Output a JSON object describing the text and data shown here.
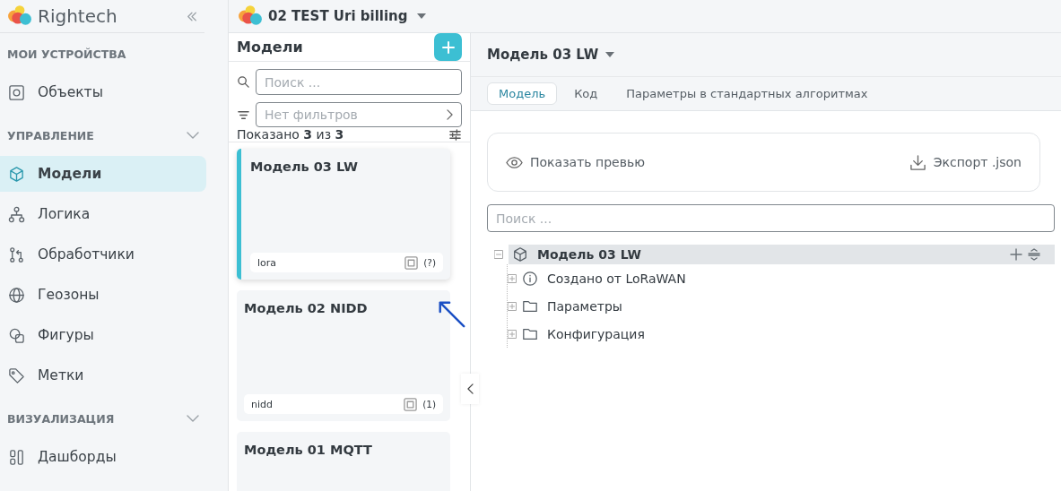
{
  "brand": {
    "name": "Rightech"
  },
  "project": {
    "title": "02 TEST Uri billing"
  },
  "sidebar": {
    "sections": [
      {
        "title": "МОИ УСТРОЙСТВА",
        "collapsible": false,
        "items": [
          {
            "label": "Объекты",
            "kind": "object",
            "selected": false
          }
        ]
      },
      {
        "title": "УПРАВЛЕНИЕ",
        "collapsible": true,
        "items": [
          {
            "label": "Модели",
            "kind": "cube",
            "selected": true
          },
          {
            "label": "Логика",
            "kind": "hierarchy",
            "selected": false
          },
          {
            "label": "Обработчики",
            "kind": "handlers",
            "selected": false
          },
          {
            "label": "Геозоны",
            "kind": "globe",
            "selected": false
          },
          {
            "label": "Фигуры",
            "kind": "shapes",
            "selected": false
          },
          {
            "label": "Метки",
            "kind": "tag",
            "selected": false
          }
        ]
      },
      {
        "title": "ВИЗУАЛИЗАЦИЯ",
        "collapsible": true,
        "items": [
          {
            "label": "Дашборды",
            "kind": "dashboard",
            "selected": false
          }
        ]
      }
    ]
  },
  "models_panel": {
    "title": "Модели",
    "search": {
      "placeholder": "Поиск ..."
    },
    "filter": {
      "placeholder": "Нет фильтров"
    },
    "count": "Показано **3** из **3**",
    "cards": [
      {
        "title": "Модель 03 LW",
        "tag": "lora",
        "count": "(?)",
        "selected": true
      },
      {
        "title": "Модель 02 NIDD",
        "tag": "nidd",
        "count": "(1)",
        "selected": false
      },
      {
        "title": "Модель 01 MQTT",
        "selected": false
      }
    ]
  },
  "detail": {
    "title": "Модель 03 LW",
    "tabs": [
      {
        "label": "Модель",
        "selected": true
      },
      {
        "label": "Код",
        "selected": false
      },
      {
        "label": "Параметры в стандартных алгоритмах",
        "selected": false
      }
    ],
    "actions": [
      {
        "label": "Показать превью",
        "kind": "eye"
      },
      {
        "label": "Экспорт .json",
        "kind": "download"
      }
    ],
    "search": {
      "placeholder": "Поиск ..."
    },
    "tree": {
      "label": "Модель 03 LW",
      "kind": "cube",
      "selected": true,
      "expanded": true,
      "children": [
        {
          "label": "Создано от LoRaWAN",
          "kind": "info",
          "expanded": false
        },
        {
          "label": "Параметры",
          "kind": "folder",
          "expanded": false
        },
        {
          "label": "Конфигурация",
          "kind": "folder",
          "expanded": false
        }
      ]
    }
  }
}
